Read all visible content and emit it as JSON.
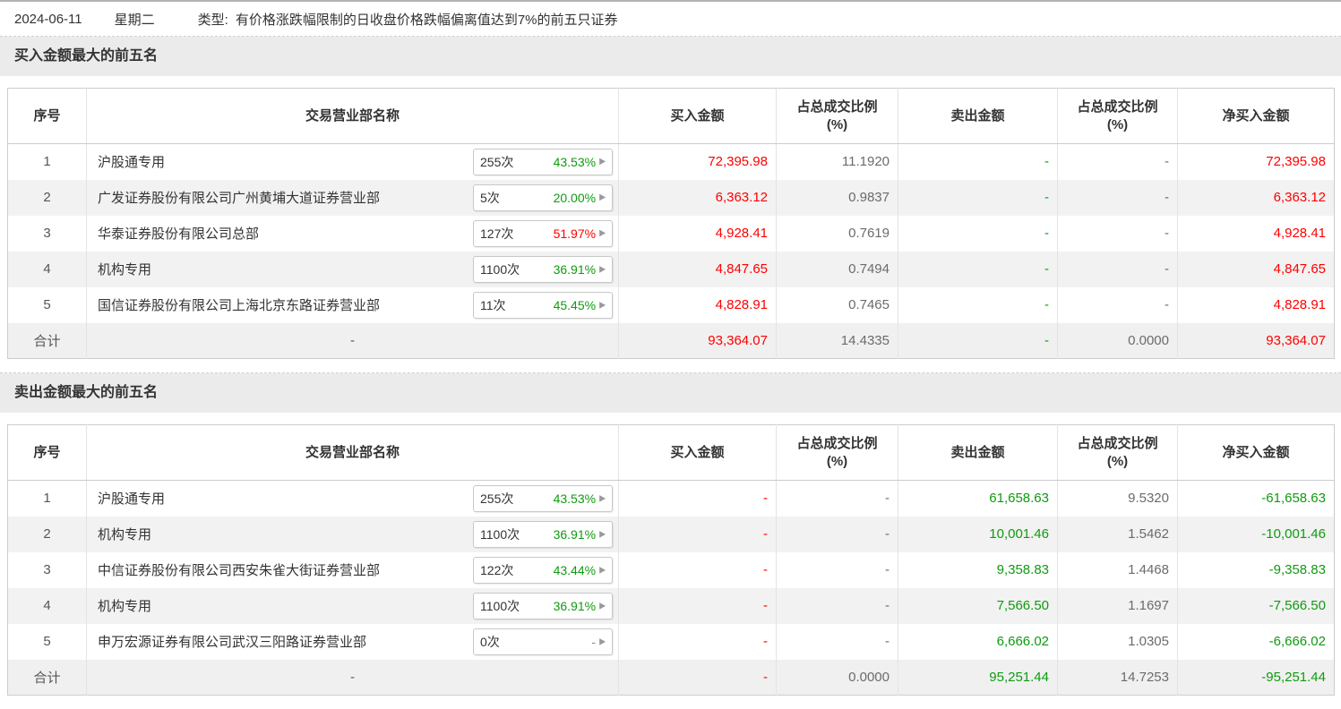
{
  "topbar": {
    "date": "2024-06-11",
    "weekday": "星期二",
    "type_label": "类型:",
    "type_text": "有价格涨跌幅限制的日收盘价格跌幅偏离值达到7%的前五只证券"
  },
  "colors": {
    "buy_red": "#fe0000",
    "sell_green": "#0f9b0f",
    "pct_gray": "#6b6b6b"
  },
  "columns": {
    "seq": "序号",
    "name": "交易营业部名称",
    "buy": "买入金额",
    "pct_line1": "占总成交比例",
    "pct_line2": "(%)",
    "sell": "卖出金额",
    "net": "净买入金额"
  },
  "buy_section": {
    "title": "买入金额最大的前五名",
    "rows": [
      {
        "seq": "1",
        "name": "沪股通专用",
        "badge_count": "255次",
        "badge_pct": "43.53%",
        "badge_pct_color": "green",
        "buy": "72,395.98",
        "buy_pct": "11.1920",
        "sell": "-",
        "sell_pct": "-",
        "net": "72,395.98"
      },
      {
        "seq": "2",
        "name": "广发证券股份有限公司广州黄埔大道证券营业部",
        "badge_count": "5次",
        "badge_pct": "20.00%",
        "badge_pct_color": "green",
        "buy": "6,363.12",
        "buy_pct": "0.9837",
        "sell": "-",
        "sell_pct": "-",
        "net": "6,363.12"
      },
      {
        "seq": "3",
        "name": "华泰证券股份有限公司总部",
        "badge_count": "127次",
        "badge_pct": "51.97%",
        "badge_pct_color": "red",
        "buy": "4,928.41",
        "buy_pct": "0.7619",
        "sell": "-",
        "sell_pct": "-",
        "net": "4,928.41"
      },
      {
        "seq": "4",
        "name": "机构专用",
        "badge_count": "1100次",
        "badge_pct": "36.91%",
        "badge_pct_color": "green",
        "buy": "4,847.65",
        "buy_pct": "0.7494",
        "sell": "-",
        "sell_pct": "-",
        "net": "4,847.65"
      },
      {
        "seq": "5",
        "name": "国信证券股份有限公司上海北京东路证券营业部",
        "badge_count": "11次",
        "badge_pct": "45.45%",
        "badge_pct_color": "green",
        "buy": "4,828.91",
        "buy_pct": "0.7465",
        "sell": "-",
        "sell_pct": "-",
        "net": "4,828.91"
      }
    ],
    "total": {
      "seq": "合计",
      "name": "-",
      "buy": "93,364.07",
      "buy_pct": "14.4335",
      "sell": "-",
      "sell_pct": "0.0000",
      "net": "93,364.07"
    }
  },
  "sell_section": {
    "title": "卖出金额最大的前五名",
    "rows": [
      {
        "seq": "1",
        "name": "沪股通专用",
        "badge_count": "255次",
        "badge_pct": "43.53%",
        "badge_pct_color": "green",
        "buy": "-",
        "buy_pct": "-",
        "sell": "61,658.63",
        "sell_pct": "9.5320",
        "net": "-61,658.63"
      },
      {
        "seq": "2",
        "name": "机构专用",
        "badge_count": "1100次",
        "badge_pct": "36.91%",
        "badge_pct_color": "green",
        "buy": "-",
        "buy_pct": "-",
        "sell": "10,001.46",
        "sell_pct": "1.5462",
        "net": "-10,001.46"
      },
      {
        "seq": "3",
        "name": "中信证券股份有限公司西安朱雀大街证券营业部",
        "badge_count": "122次",
        "badge_pct": "43.44%",
        "badge_pct_color": "green",
        "buy": "-",
        "buy_pct": "-",
        "sell": "9,358.83",
        "sell_pct": "1.4468",
        "net": "-9,358.83"
      },
      {
        "seq": "4",
        "name": "机构专用",
        "badge_count": "1100次",
        "badge_pct": "36.91%",
        "badge_pct_color": "green",
        "buy": "-",
        "buy_pct": "-",
        "sell": "7,566.50",
        "sell_pct": "1.1697",
        "net": "-7,566.50"
      },
      {
        "seq": "5",
        "name": "申万宏源证券有限公司武汉三阳路证券营业部",
        "badge_count": "0次",
        "badge_pct": "-",
        "badge_pct_color": "gray",
        "buy": "-",
        "buy_pct": "-",
        "sell": "6,666.02",
        "sell_pct": "1.0305",
        "net": "-6,666.02"
      }
    ],
    "total": {
      "seq": "合计",
      "name": "-",
      "buy": "-",
      "buy_pct": "0.0000",
      "sell": "95,251.44",
      "sell_pct": "14.7253",
      "net": "-95,251.44"
    }
  }
}
